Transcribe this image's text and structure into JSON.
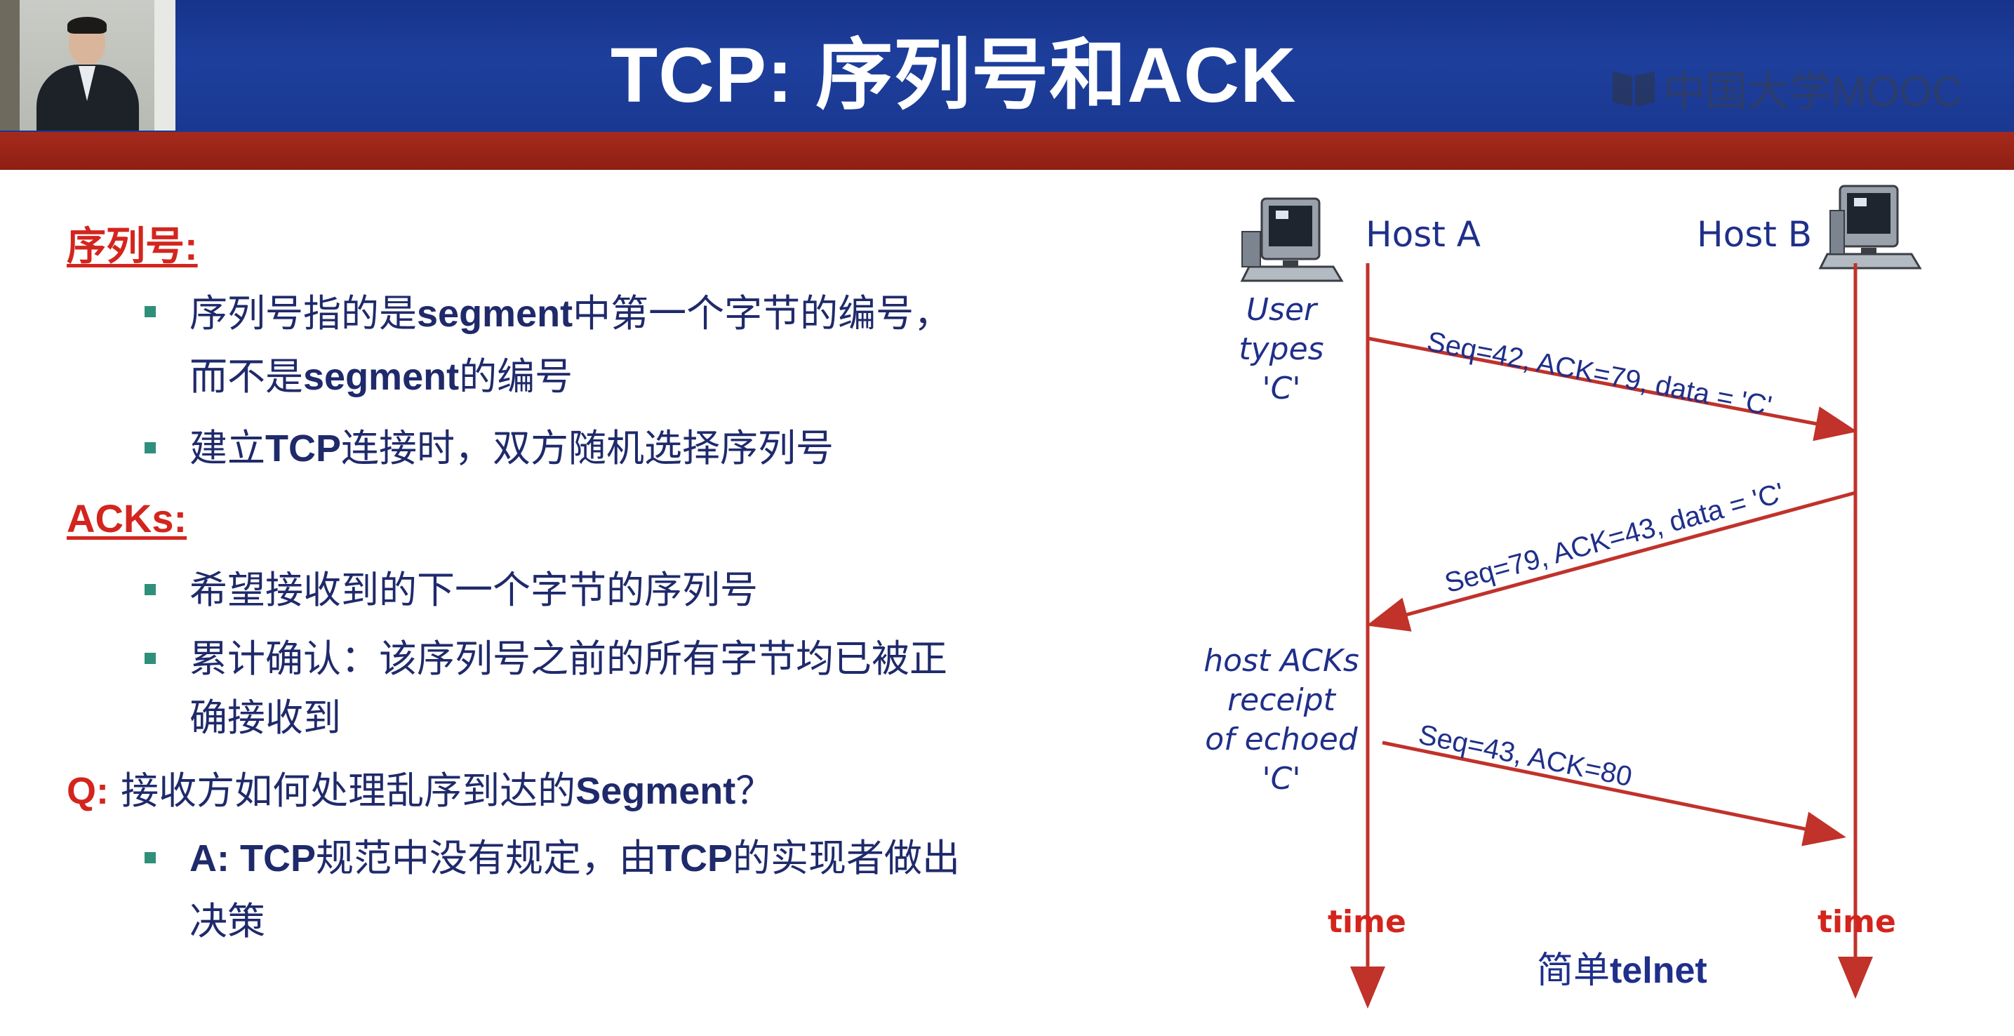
{
  "header": {
    "title": "TCP: 序列号和ACK",
    "logo_text": "中国大学MOOC"
  },
  "left": {
    "seq_heading": "序列号:",
    "seq_bullets": [
      {
        "l1_a": "序列号指的是",
        "l1_b": "segment",
        "l1_c": "中第一个字节的编号，",
        "l2_a": "而不是",
        "l2_b": "segment",
        "l2_c": "的编号"
      },
      {
        "a": "建立",
        "b": "TCP",
        "c": "连接时，双方随机选择序列号"
      }
    ],
    "ack_heading": "ACKs:",
    "ack_bullets": [
      {
        "a": "希望接收到的下一个字节的序列号"
      },
      {
        "l1": "累计确认：该序列号之前的所有字节均已被正",
        "l2": "确接收到"
      }
    ],
    "q": {
      "label": "Q:",
      "a": " 接收方如何处理乱序到达的",
      "b": "Segment",
      "c": "？"
    },
    "answer": {
      "a": "A: TCP",
      "b": "规范中没有规定，由",
      "c": "TCP",
      "d": "的实现者做出",
      "l2": "决策"
    }
  },
  "diagram": {
    "host_a": "Host A",
    "host_b": "Host B",
    "note_user": [
      "User",
      "types",
      "'C'"
    ],
    "note_host": [
      "host ACKs",
      "receipt",
      "of echoed",
      "'C'"
    ],
    "msg1": "Seq=42, ACK=79, data = 'C'",
    "msg2": "Seq=79, ACK=43, data = 'C'",
    "msg3": "Seq=43, ACK=80",
    "time_a": "time",
    "time_b": "time",
    "caption_a": "简单",
    "caption_b": "telnet",
    "colors": {
      "timeline": "#c0322a",
      "text": "#1f2f8a"
    }
  }
}
